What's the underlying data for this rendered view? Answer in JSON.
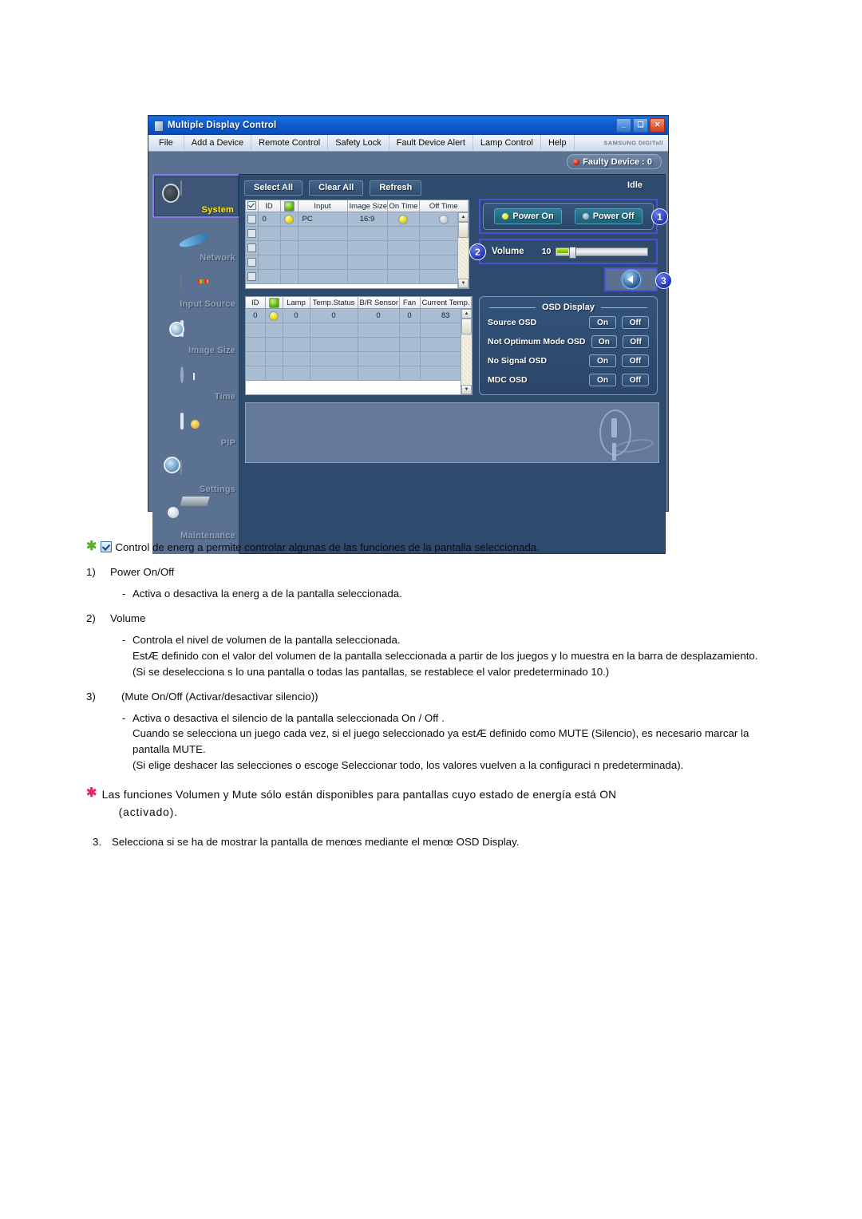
{
  "window": {
    "title": "Multiple Display Control",
    "brand_logo": "SAMSUNG DIGITall",
    "minimize_label": "_",
    "maximize_label": "❑",
    "close_label": "✕",
    "menu": [
      "File",
      "Add a Device",
      "Remote Control",
      "Safety Lock",
      "Fault Device Alert",
      "Lamp Control",
      "Help"
    ],
    "faulty_device": "Faulty Device : 0"
  },
  "sidebar": {
    "items": [
      {
        "label": "System",
        "icon": "camera-system-icon",
        "active": true
      },
      {
        "label": "Network",
        "icon": "globe-network-icon",
        "active": false
      },
      {
        "label": "Input Source",
        "icon": "input-source-icon",
        "active": false
      },
      {
        "label": "Image Size",
        "icon": "image-size-icon",
        "active": false
      },
      {
        "label": "Time",
        "icon": "clock-time-icon",
        "active": false
      },
      {
        "label": "PIP",
        "icon": "pip-icon",
        "active": false
      },
      {
        "label": "Settings",
        "icon": "settings-cube-icon",
        "active": false
      },
      {
        "label": "Maintenance",
        "icon": "maintenance-icon",
        "active": false
      }
    ]
  },
  "toolbar": {
    "select_all": "Select All",
    "clear_all": "Clear All",
    "refresh": "Refresh",
    "status": "Idle"
  },
  "display_table": {
    "headers": [
      "",
      "ID",
      "",
      "Input",
      "Image Size",
      "On Time",
      "Off Time"
    ],
    "power_header_icon": "power-icon",
    "rows": [
      {
        "checked": false,
        "id": "0",
        "power": "yellow",
        "input": "PC",
        "image_size": "16:9",
        "on_time": "yellow",
        "off_time": "gray"
      },
      {
        "checked": false,
        "id": "",
        "power": "",
        "input": "",
        "image_size": "",
        "on_time": "",
        "off_time": ""
      },
      {
        "checked": false,
        "id": "",
        "power": "",
        "input": "",
        "image_size": "",
        "on_time": "",
        "off_time": ""
      },
      {
        "checked": false,
        "id": "",
        "power": "",
        "input": "",
        "image_size": "",
        "on_time": "",
        "off_time": ""
      },
      {
        "checked": false,
        "id": "",
        "power": "",
        "input": "",
        "image_size": "",
        "on_time": "",
        "off_time": ""
      }
    ]
  },
  "status_table": {
    "headers": [
      "ID",
      "",
      "Lamp",
      "Temp.Status",
      "B/R Sensor",
      "Fan",
      "Current Temp."
    ],
    "power_header_icon": "power-icon",
    "rows": [
      {
        "id": "0",
        "power": "yellow",
        "lamp": "0",
        "temp_status": "0",
        "br_sensor": "0",
        "fan": "0",
        "current_temp": "83"
      },
      {
        "id": "",
        "power": "",
        "lamp": "",
        "temp_status": "",
        "br_sensor": "",
        "fan": "",
        "current_temp": ""
      },
      {
        "id": "",
        "power": "",
        "lamp": "",
        "temp_status": "",
        "br_sensor": "",
        "fan": "",
        "current_temp": ""
      },
      {
        "id": "",
        "power": "",
        "lamp": "",
        "temp_status": "",
        "br_sensor": "",
        "fan": "",
        "current_temp": ""
      },
      {
        "id": "",
        "power": "",
        "lamp": "",
        "temp_status": "",
        "br_sensor": "",
        "fan": "",
        "current_temp": ""
      }
    ]
  },
  "power_panel": {
    "power_on": "Power On",
    "power_off": "Power Off",
    "callout": "1"
  },
  "volume_panel": {
    "label": "Volume",
    "value": "10",
    "slider_percent": 6,
    "callout": "2"
  },
  "mute_panel": {
    "icon": "speaker-mute-icon",
    "callout": "3"
  },
  "osd_panel": {
    "title": "OSD Display",
    "on_label": "On",
    "off_label": "Off",
    "rows": [
      "Source OSD",
      "Not Optimum Mode OSD",
      "No Signal OSD",
      "MDC OSD"
    ]
  },
  "info_panel": {
    "watermark_icon": "exclamation-mark-icon"
  },
  "document": {
    "intro": "Control de energ a permite controlar algunas de las funciones de la pantalla seleccionada.",
    "item1": {
      "num": "1)",
      "title": "Power On/Off",
      "lines": [
        "Activa o desactiva la energ a de la pantalla seleccionada."
      ]
    },
    "item2": {
      "num": "2)",
      "title": "Volume",
      "lines": [
        "Controla el nivel de volumen de la pantalla seleccionada.",
        "EstÆ definido con el valor del volumen de la pantalla seleccionada a partir de los juegos y lo muestra en la barra de desplazamiento.",
        "(Si se deselecciona s lo una pantalla o todas las pantallas, se restablece el valor predeterminado 10.)"
      ]
    },
    "item3": {
      "num": "3)",
      "title": "(Mute On/Off (Activar/desactivar silencio))",
      "lines": [
        "Activa o desactiva el silencio de la pantalla seleccionada On / Off .",
        "Cuando se selecciona un juego cada vez, si el juego seleccionado ya estÆ definido como MUTE (Silencio), es necesario marcar la pantalla MUTE.",
        "(Si elige deshacer las selecciones o escoge Seleccionar todo, los valores vuelven a la configuraci n predeterminada)."
      ]
    },
    "note": {
      "line1": "Las funciones Volumen y Mute sólo están disponibles para pantallas cuyo estado de energía está ON",
      "line2": "(activado)."
    },
    "item_last": {
      "num": "3.",
      "text": "Selecciona si se ha de mostrar la pantalla de menœs mediante el menœ OSD Display."
    }
  }
}
